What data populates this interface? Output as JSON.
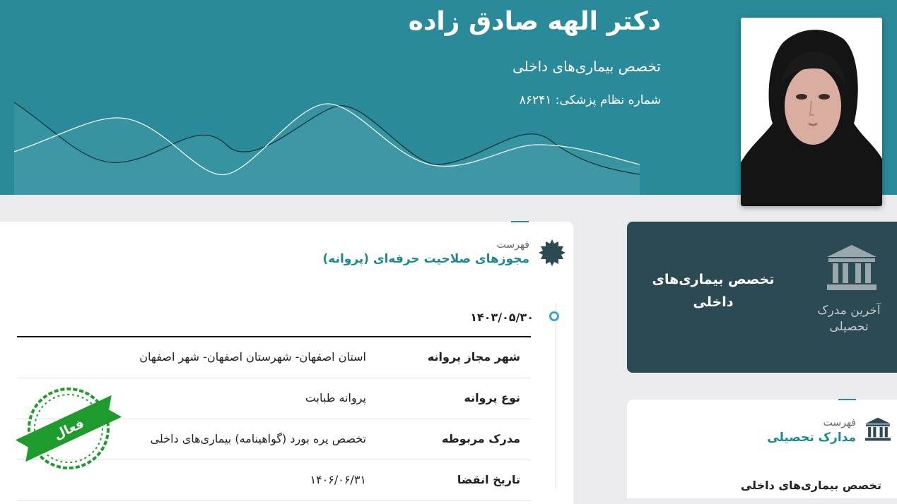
{
  "doctor": {
    "name": "دکتر الهه صادق زاده",
    "specialty": "تخصص بیماری‌های داخلی",
    "medical_code": "شماره نظام پزشکی: ۸۶۲۴۱"
  },
  "licenses": {
    "list_label": "فهرست",
    "title": "مجوزهای صلاحیت حرفه‌ای (پروانه)",
    "date": "۱۴۰۳/۰۵/۳۰",
    "rows": [
      {
        "key": "شهر مجاز پروانه",
        "value": "استان اصفهان- شهرستان اصفهان- شهر اصفهان"
      },
      {
        "key": "نوع پروانه",
        "value": "پروانه طبابت"
      },
      {
        "key": "مدرک مربوطه",
        "value": "تخصص پره بورد (گواهینامه) بیماری‌های داخلی"
      },
      {
        "key": "تاریخ انقضا",
        "value": "۱۴۰۶/۰۶/۳۱"
      }
    ],
    "stamp_text": "فعال"
  },
  "latest_degree": {
    "label": "آخرین مدرک تحصیلی",
    "value": "تخصص بیماری‌های داخلی"
  },
  "education": {
    "list_label": "فهرست",
    "title": "مدارک تحصیلی",
    "first_item": "تخصص بیماری‌های داخلی"
  },
  "colors": {
    "header": "#2a8a9a",
    "dark_card": "#2c4a53",
    "accent_text": "#1b8a8f",
    "stamp": "#1f9a2c"
  },
  "icons": {
    "license_icon": "badge-icon",
    "degree_icon": "bank-icon",
    "education_icon": "bank-icon",
    "timeline": "timeline-dot"
  }
}
